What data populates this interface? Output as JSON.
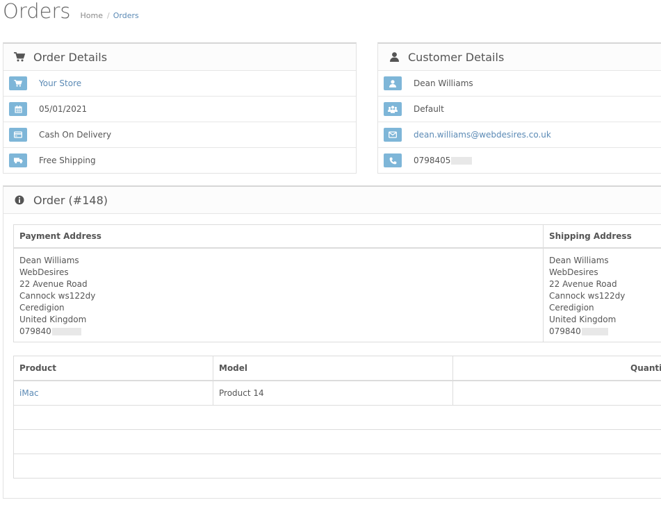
{
  "page": {
    "title": "Orders",
    "breadcrumb": [
      {
        "label": "Home"
      },
      {
        "label": "Orders"
      }
    ]
  },
  "order_details": {
    "title": "Order Details",
    "store": "Your Store",
    "date": "05/01/2021",
    "payment_method": "Cash On Delivery",
    "shipping_method": "Free Shipping"
  },
  "customer_details": {
    "title": "Customer Details",
    "name": "Dean Williams",
    "group": "Default",
    "email": "dean.williams@webdesires.co.uk",
    "phone": "0798405"
  },
  "order": {
    "title": "Order (#148)",
    "payment_address_header": "Payment Address",
    "shipping_address_header": "Shipping Address",
    "payment_address": {
      "name": "Dean Williams",
      "company": "WebDesires",
      "street": "22 Avenue Road",
      "city": "Cannock ws122dy",
      "region": "Ceredigion",
      "country": "United Kingdom",
      "phone": "079840"
    },
    "shipping_address": {
      "name": "Dean Williams",
      "company": "WebDesires",
      "street": "22 Avenue Road",
      "city": "Cannock ws122dy",
      "region": "Ceredigion",
      "country": "United Kingdom",
      "phone": "079840"
    },
    "products_table": {
      "headers": {
        "product": "Product",
        "model": "Model",
        "quantity": "Quantit"
      },
      "rows": [
        {
          "product": "iMac",
          "model": "Product 14"
        }
      ]
    }
  },
  "colors": {
    "badge": "#7eb6d8",
    "link": "#5b8ab5"
  }
}
